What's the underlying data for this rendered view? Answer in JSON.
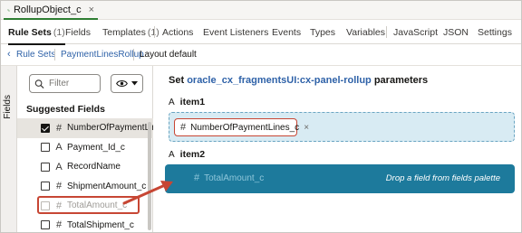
{
  "document_tab": {
    "title": "RollupObject_c",
    "close_icon": "close-icon",
    "object_icon": "rollup-object-icon"
  },
  "main_tabs": [
    {
      "label": "Rule Sets",
      "count": "(1)",
      "active": true
    },
    {
      "label": "Fields",
      "count": "",
      "active": false
    },
    {
      "label": "Templates",
      "count": "(1)",
      "active": false
    },
    {
      "label": "Actions",
      "count": "",
      "active": false
    },
    {
      "label": "Event Listeners",
      "count": "",
      "active": false
    },
    {
      "label": "Events",
      "count": "",
      "active": false
    },
    {
      "label": "Types",
      "count": "",
      "active": false
    },
    {
      "label": "Variables",
      "count": "",
      "active": false
    },
    {
      "label": "JavaScript",
      "count": "",
      "active": false
    },
    {
      "label": "JSON",
      "count": "",
      "active": false
    },
    {
      "label": "Settings",
      "count": "",
      "active": false
    }
  ],
  "breadcrumb": {
    "back_icon": "chevron-left-icon",
    "root": "Rule Sets",
    "ruleset": "PaymentLinesRollup",
    "layout": "Layout default"
  },
  "side_rail": {
    "label": "Fields"
  },
  "fields_panel": {
    "filter_placeholder": "Filter",
    "search_icon": "search-icon",
    "view_icon": "eye-icon",
    "view_menu_icon": "caret-down-icon",
    "section_title": "Suggested Fields",
    "fields": [
      {
        "name": "NumberOfPaymentLines_c",
        "type_icon": "#",
        "checked": true,
        "disabled": false,
        "selected": true
      },
      {
        "name": "Payment_Id_c",
        "type_icon": "A",
        "checked": false,
        "disabled": false,
        "selected": false
      },
      {
        "name": "RecordName",
        "type_icon": "A",
        "checked": false,
        "disabled": false,
        "selected": false
      },
      {
        "name": "ShipmentAmount_c",
        "type_icon": "#",
        "checked": false,
        "disabled": false,
        "selected": false
      },
      {
        "name": "TotalAmount_c",
        "type_icon": "#",
        "checked": false,
        "disabled": true,
        "selected": false
      },
      {
        "name": "TotalShipment_c",
        "type_icon": "#",
        "checked": false,
        "disabled": false,
        "selected": false
      }
    ]
  },
  "editor": {
    "title_prefix": "Set",
    "component": "oracle_cx_fragmentsUI:cx-panel-rollup",
    "title_suffix": "parameters",
    "items": [
      {
        "label": "item1",
        "type_icon": "A",
        "chip": "NumberOfPaymentLines_c",
        "chip_icon": "#",
        "chip_close": "×"
      },
      {
        "label": "item2",
        "type_icon": "A",
        "ghost": "TotalAmount_c",
        "ghost_icon": "#",
        "hint": "Drop a field from fields palette"
      }
    ]
  },
  "annotation": {
    "highlight_color": "#c74634",
    "arrow": "drag-arrow"
  }
}
